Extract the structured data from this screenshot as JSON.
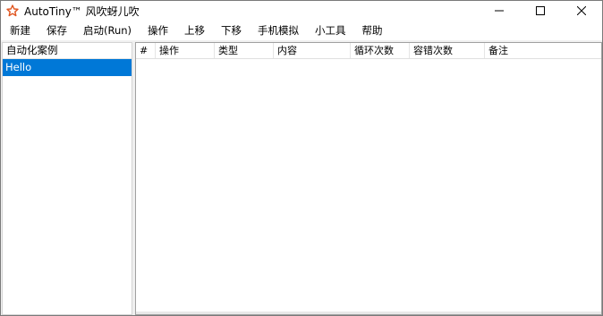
{
  "window": {
    "title": "AutoTiny™ 风吹蚜儿吹"
  },
  "icons": {
    "app": "star-outline-icon",
    "minimize": "minimize-icon",
    "maximize": "maximize-icon",
    "close": "close-icon"
  },
  "colors": {
    "accent": "#0078d7",
    "app_icon": "#e0541e"
  },
  "menu": {
    "items": [
      {
        "label": "新建"
      },
      {
        "label": "保存"
      },
      {
        "label": "启动(Run)"
      },
      {
        "label": "操作"
      },
      {
        "label": "上移"
      },
      {
        "label": "下移"
      },
      {
        "label": "手机模拟"
      },
      {
        "label": "小工具"
      },
      {
        "label": "帮助"
      }
    ]
  },
  "left_panel": {
    "header": "自动化案例",
    "items": [
      {
        "label": "Hello",
        "selected": true
      }
    ]
  },
  "grid": {
    "columns": [
      {
        "label": "#"
      },
      {
        "label": "操作"
      },
      {
        "label": "类型"
      },
      {
        "label": "内容"
      },
      {
        "label": "循环次数"
      },
      {
        "label": "容错次数"
      },
      {
        "label": "备注"
      }
    ],
    "rows": []
  }
}
